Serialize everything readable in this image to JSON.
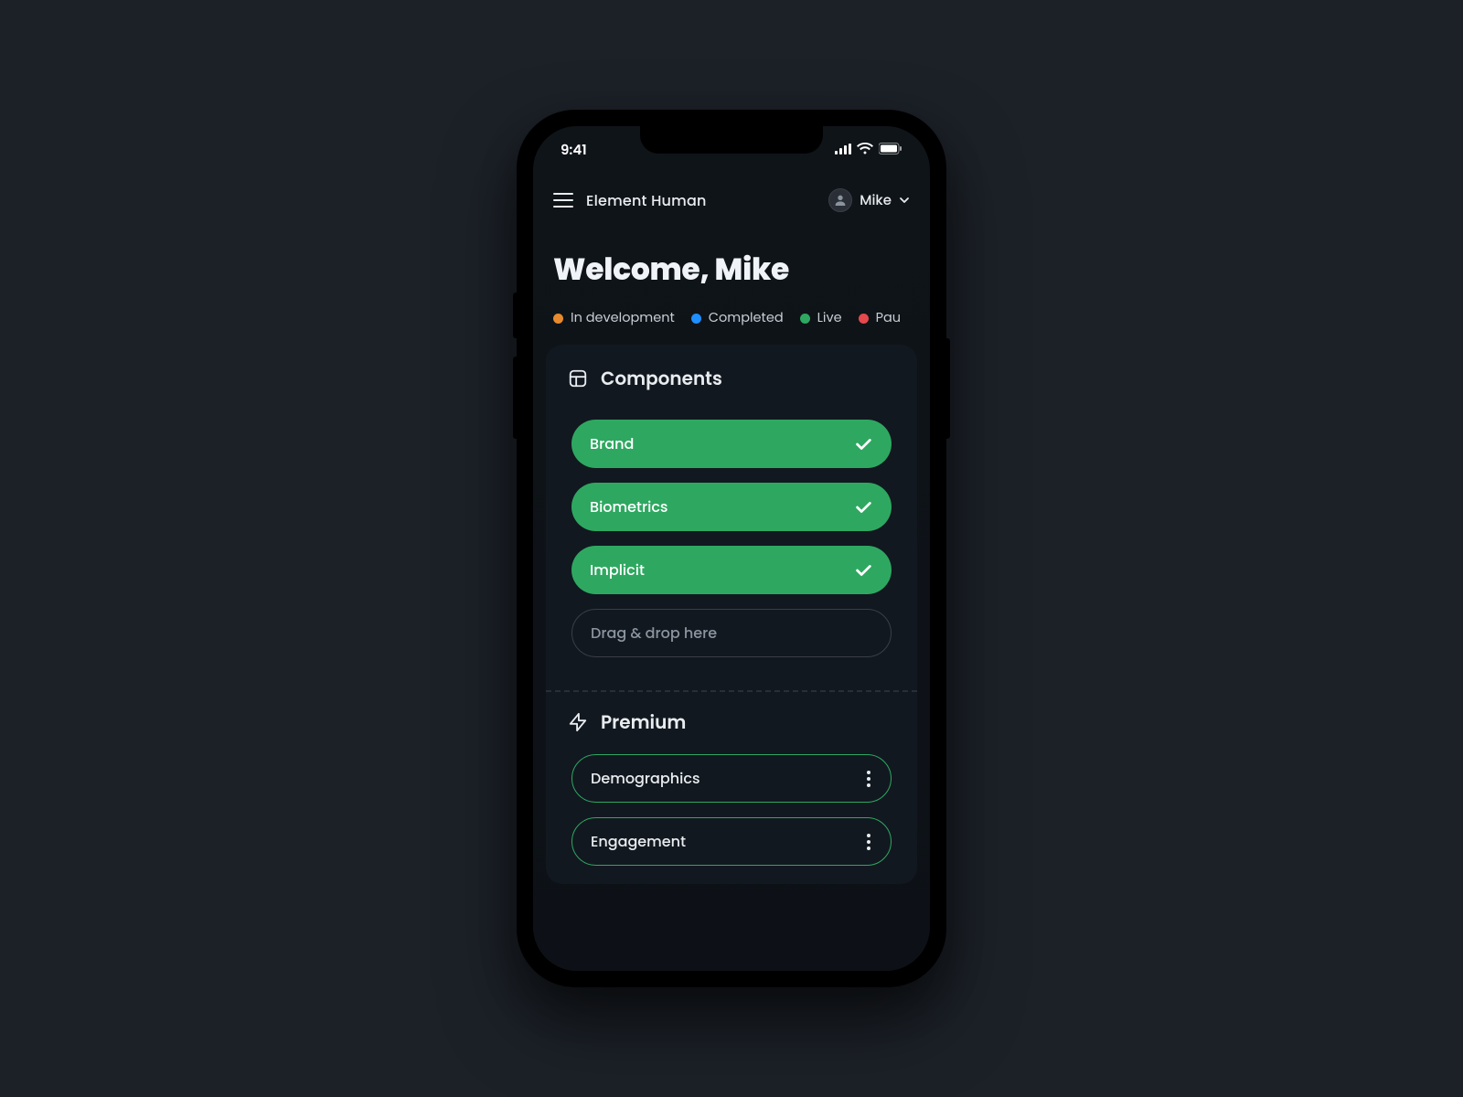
{
  "status": {
    "time": "9:41"
  },
  "nav": {
    "app_title": "Element Human",
    "user_name": "Mike"
  },
  "welcome_text": "Welcome, Mike",
  "legend": [
    {
      "label": "In development",
      "color": "#e78a2e"
    },
    {
      "label": "Completed",
      "color": "#1f8fff"
    },
    {
      "label": "Live",
      "color": "#2ea860"
    },
    {
      "label": "Pau",
      "color": "#e5484d"
    }
  ],
  "components": {
    "title": "Components",
    "items": [
      {
        "label": "Brand"
      },
      {
        "label": "Biometrics"
      },
      {
        "label": "Implicit"
      }
    ],
    "drop_label": "Drag & drop here"
  },
  "premium": {
    "title": "Premium",
    "items": [
      {
        "label": "Demographics"
      },
      {
        "label": "Engagement"
      }
    ]
  }
}
